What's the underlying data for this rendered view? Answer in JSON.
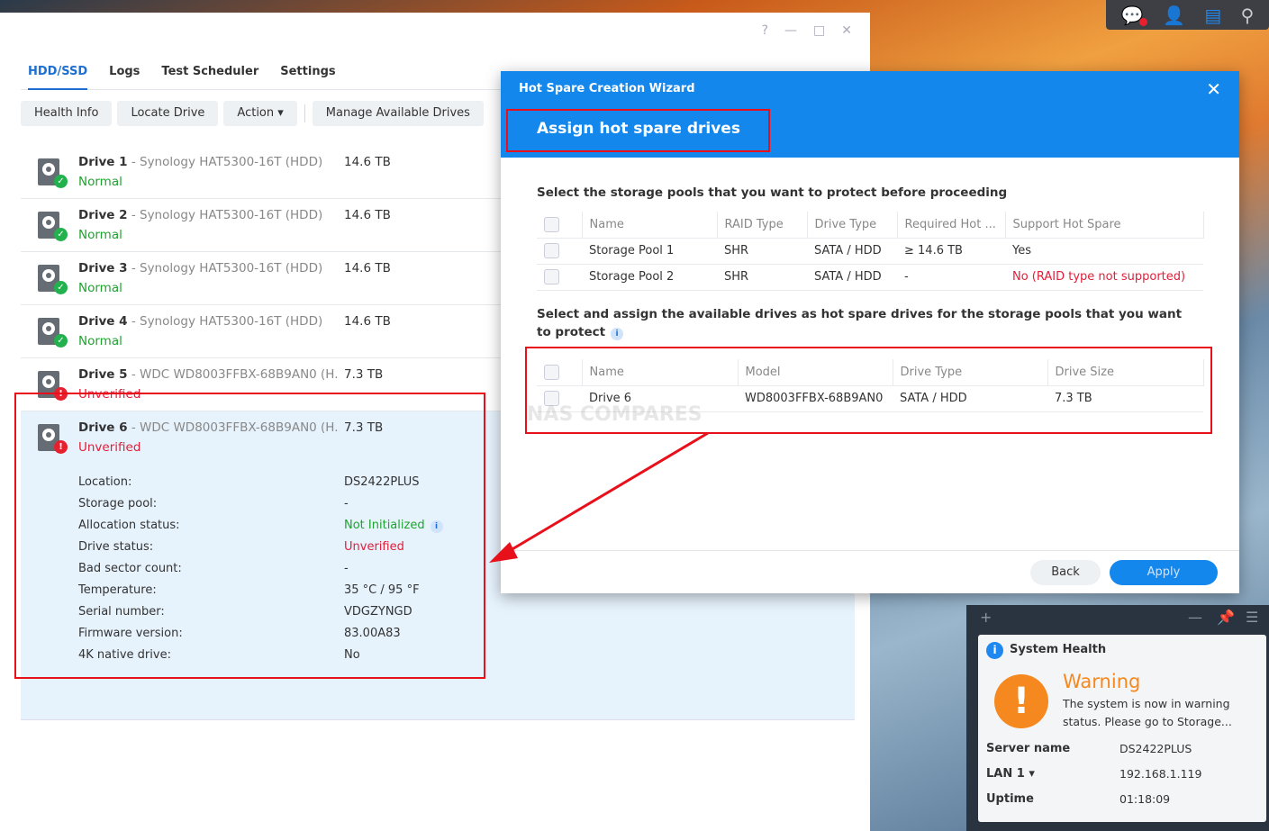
{
  "topbar": {
    "icons": [
      "notification-icon",
      "user-icon",
      "widgets-icon",
      "search-icon"
    ]
  },
  "window": {
    "controls": [
      "?",
      "—",
      "□",
      "✕"
    ],
    "tabs": [
      "HDD/SSD",
      "Logs",
      "Test Scheduler",
      "Settings"
    ],
    "toolbar": {
      "health_info": "Health Info",
      "locate_drive": "Locate Drive",
      "action": "Action ▾",
      "manage": "Manage Available Drives"
    },
    "drives": [
      {
        "name": "Drive 1",
        "model": " - Synology HAT5300-16T (HDD)",
        "size": "14.6 TB",
        "status": "Normal"
      },
      {
        "name": "Drive 2",
        "model": " - Synology HAT5300-16T (HDD)",
        "size": "14.6 TB",
        "status": "Normal"
      },
      {
        "name": "Drive 3",
        "model": " - Synology HAT5300-16T (HDD)",
        "size": "14.6 TB",
        "status": "Normal"
      },
      {
        "name": "Drive 4",
        "model": " - Synology HAT5300-16T (HDD)",
        "size": "14.6 TB",
        "status": "Normal"
      },
      {
        "name": "Drive 5",
        "model": " - WDC WD8003FFBX-68B9AN0 (H...",
        "size": "7.3 TB",
        "status": "Unverified"
      },
      {
        "name": "Drive 6",
        "model": " - WDC WD8003FFBX-68B9AN0 (H...",
        "size": "7.3 TB",
        "status": "Unverified"
      }
    ],
    "details": [
      {
        "label": "Location:",
        "value": "DS2422PLUS"
      },
      {
        "label": "Storage pool:",
        "value": "-"
      },
      {
        "label": "Allocation status:",
        "value": "Not Initialized"
      },
      {
        "label": "Drive status:",
        "value": "Unverified"
      },
      {
        "label": "Bad sector count:",
        "value": "-"
      },
      {
        "label": "Temperature:",
        "value": "35 °C / 95 °F"
      },
      {
        "label": "Serial number:",
        "value": "VDGZYNGD"
      },
      {
        "label": "Firmware version:",
        "value": "83.00A83"
      },
      {
        "label": "4K native drive:",
        "value": "No"
      }
    ]
  },
  "dialog": {
    "title": "Hot Spare Creation Wizard",
    "close": "✕",
    "subtitle": "Assign hot spare drives",
    "section1": "Select the storage pools that you want to protect before proceeding",
    "pool_headers": [
      "Name",
      "RAID Type",
      "Drive Type",
      "Required Hot ...",
      "Support Hot Spare"
    ],
    "pools": [
      [
        "Storage Pool 1",
        "SHR",
        "SATA / HDD",
        "≥ 14.6 TB",
        "Yes"
      ],
      [
        "Storage Pool 2",
        "SHR",
        "SATA / HDD",
        "-",
        "No (RAID type not supported)"
      ]
    ],
    "section2": "Select and assign the available drives as hot spare drives for the storage pools that you want to protect",
    "drive_headers": [
      "Name",
      "Model",
      "Drive Type",
      "Drive Size"
    ],
    "drives": [
      [
        "Drive 6",
        "WD8003FFBX-68B9AN0",
        "SATA / HDD",
        "7.3 TB"
      ]
    ],
    "back": "Back",
    "apply": "Apply",
    "watermark": "NAS COMPARES"
  },
  "widget": {
    "title": "System Health",
    "status": "Warning",
    "message": "The system is now in warning status. Please go to Storage...",
    "rows": [
      {
        "label": "Server name",
        "value": "DS2422PLUS"
      },
      {
        "label": "LAN 1 ▾",
        "value": "192.168.1.119"
      },
      {
        "label": "Uptime",
        "value": "01:18:09"
      }
    ]
  },
  "colors": {
    "accent": "#1387ec",
    "normal": "#1fa32f",
    "unverified": "#e0203a",
    "warning": "#f5881e",
    "highlight": "#e8101a"
  }
}
